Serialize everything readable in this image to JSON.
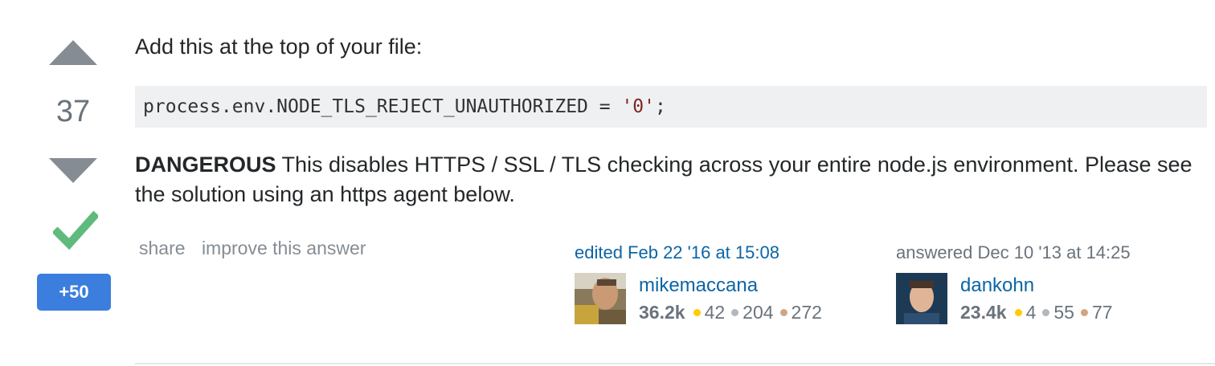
{
  "vote": {
    "count": "37",
    "bounty_label": "+50"
  },
  "post": {
    "intro": "Add this at the top of your file:",
    "code_prefix": "process.env.NODE_TLS_REJECT_UNAUTHORIZED = ",
    "code_string": "'0'",
    "code_suffix": ";",
    "warning_bold": "DANGEROUS",
    "warning_text": " This disables HTTPS / SSL / TLS checking across your entire node.js environment. Please see the solution using an https agent below."
  },
  "actions": {
    "share": "share",
    "improve": "improve this answer"
  },
  "editor": {
    "action": "edited Feb 22 '16 at 15:08",
    "name": "mikemaccana",
    "reputation": "36.2k",
    "gold": "42",
    "silver": "204",
    "bronze": "272"
  },
  "author": {
    "action": "answered Dec 10 '13 at 14:25",
    "name": "dankohn",
    "reputation": "23.4k",
    "gold": "4",
    "silver": "55",
    "bronze": "77"
  },
  "colors": {
    "link": "#0c65a5",
    "accepted": "#5eba7d",
    "bounty": "#3b7edd",
    "vote_arrow": "#858c93"
  },
  "icons": {
    "upvote": "upvote-arrow-icon",
    "downvote": "downvote-arrow-icon",
    "accepted": "checkmark-icon"
  }
}
